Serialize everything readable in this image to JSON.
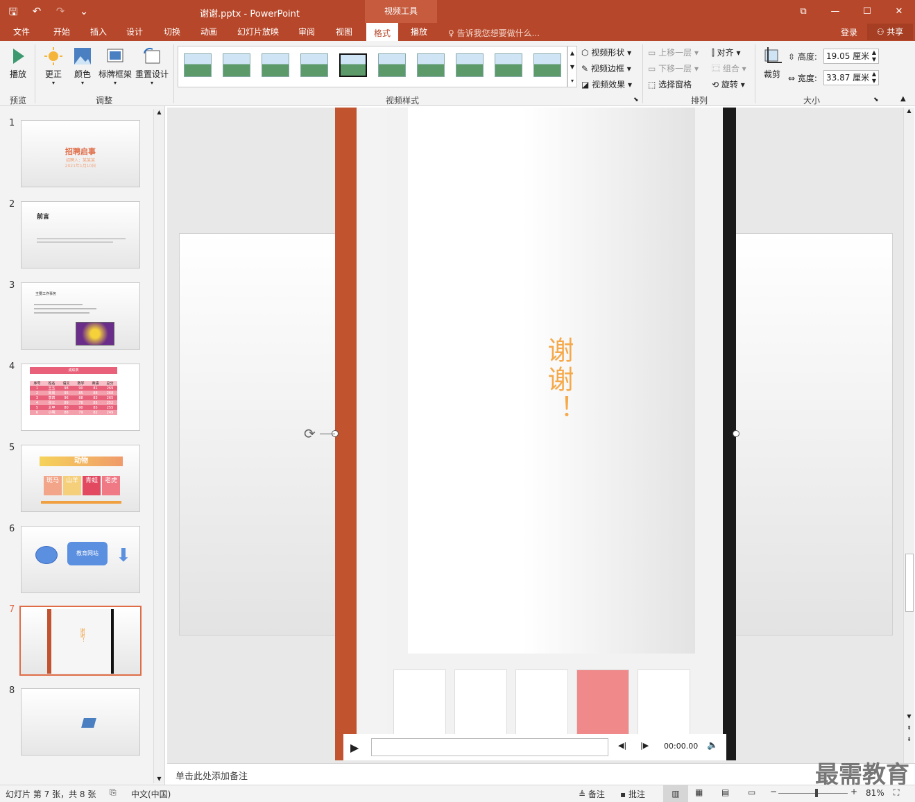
{
  "titlebar": {
    "doc_title": "谢谢.pptx - PowerPoint",
    "context_tab": "视频工具",
    "qat": {
      "save": "🖫",
      "undo": "↶",
      "redo": "↷",
      "custom": "⌄"
    },
    "win": {
      "restore": "⧉",
      "minimize": "—",
      "maximize": "☐",
      "close": "✕"
    }
  },
  "tabs": {
    "file": "文件",
    "home": "开始",
    "insert": "插入",
    "design": "设计",
    "transitions": "切换",
    "animations": "动画",
    "slideshow": "幻灯片放映",
    "review": "审阅",
    "view": "视图",
    "format": "格式",
    "playback": "播放"
  },
  "tell_me": "告诉我您想要做什么...",
  "login": "登录",
  "share": "共享",
  "ribbon": {
    "play": "播放",
    "correct": "更正",
    "color": "颜色",
    "poster": "标牌框架",
    "reset": "重置设计",
    "video_shape": "视频形状",
    "video_border": "视频边框",
    "video_effects": "视频效果",
    "bring_forward": "上移一层",
    "send_backward": "下移一层",
    "selection_pane": "选择窗格",
    "align": "对齐",
    "group": "组合",
    "rotate": "旋转",
    "crop": "裁剪",
    "height_label": "高度:",
    "height_value": "19.05 厘米",
    "width_label": "宽度:",
    "width_value": "33.87 厘米",
    "groups": {
      "preview": "预览",
      "adjust": "调整",
      "video_styles": "视频样式",
      "arrange": "排列",
      "size": "大小"
    }
  },
  "slides": [
    {
      "num": "1",
      "title": "招聘启事",
      "sub": "招聘人：某某某",
      "date": "2021年1月10日"
    },
    {
      "num": "2",
      "title": "前言"
    },
    {
      "num": "3",
      "title": "主要工作事务"
    },
    {
      "num": "4",
      "title": "成绩表"
    },
    {
      "num": "5",
      "title": "动物",
      "cells": [
        "斑马",
        "山羊",
        "青蛙",
        "老虎"
      ]
    },
    {
      "num": "6",
      "label": "教育网站"
    },
    {
      "num": "7",
      "text": "谢谢！"
    },
    {
      "num": "8"
    }
  ],
  "grade_table": {
    "headers": [
      "序号",
      "姓名",
      "语文",
      "数学",
      "英语",
      "总分"
    ],
    "rows": [
      [
        "1",
        "王五",
        "98",
        "90",
        "81",
        "269"
      ],
      [
        "2",
        "周周",
        "95",
        "85",
        "88",
        "268"
      ],
      [
        "3",
        "李四",
        "96",
        "88",
        "83",
        "265"
      ],
      [
        "4",
        "张三",
        "89",
        "78",
        "85",
        "252"
      ],
      [
        "5",
        "太甲",
        "80",
        "90",
        "85",
        "255"
      ],
      [
        "6",
        "小明",
        "88",
        "79",
        "82",
        "249"
      ]
    ]
  },
  "video": {
    "slide_text": "谢谢！",
    "time": "00:00.00",
    "progress": 0
  },
  "notes_placeholder": "单击此处添加备注",
  "watermark": "最需教育",
  "status": {
    "slide_info": "幻灯片 第 7 张，共 8 张",
    "language": "中文(中国)",
    "notes": "备注",
    "comments": "批注",
    "zoom": "81%",
    "zoom_fraction": 0.55
  },
  "colors": {
    "accent": "#b7472a",
    "active_slide_border": "#e06c47"
  }
}
